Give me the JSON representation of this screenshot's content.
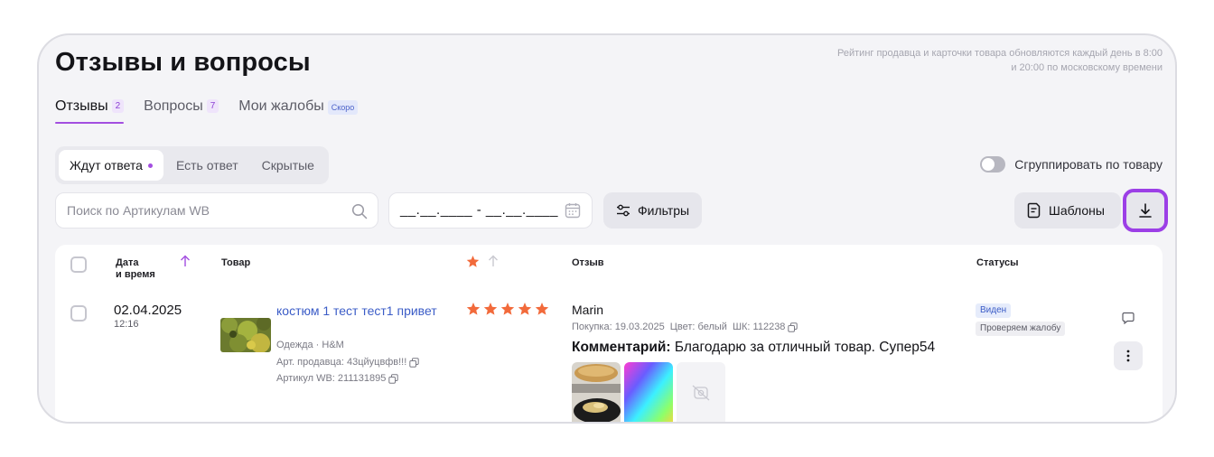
{
  "page": {
    "title": "Отзывы и вопросы",
    "info_note": "Рейтинг продавца и карточки товара обновляются каждый день в 8:00 и 20:00 по московскому времени"
  },
  "tabs": [
    {
      "label": "Отзывы",
      "count": "2"
    },
    {
      "label": "Вопросы",
      "count": "7"
    },
    {
      "label": "Мои жалобы",
      "badge": "Скоро"
    }
  ],
  "segments": [
    {
      "label": "Ждут ответа"
    },
    {
      "label": "Есть ответ"
    },
    {
      "label": "Скрытые"
    }
  ],
  "group_toggle": {
    "label": "Сгруппировать по товару"
  },
  "search": {
    "placeholder": "Поиск по Артикулам WB"
  },
  "date_range": {
    "value": "__.__.____ - __.__.____"
  },
  "toolbar": {
    "filters_label": "Фильтры",
    "templates_label": "Шаблоны"
  },
  "table": {
    "headers": {
      "date": "Дата\nи время",
      "product": "Товар",
      "review": "Отзыв",
      "statuses": "Статусы"
    }
  },
  "review": {
    "date": "02.04.2025",
    "time": "12:16",
    "product": {
      "name": "костюм 1 тест тест1 привет",
      "category": "Одежда · H&M",
      "seller_article": "Арт. продавца: 43цйуцвфв!!!",
      "wb_article": "Артикул WB: 211131895"
    },
    "rating": 5,
    "reviewer": "Marin",
    "purchase": "Покупка: 19.03.2025",
    "color": "Цвет: белый",
    "shk": "ШК: 112238",
    "comment_label": "Комментарий:",
    "comment_text": " Благодарю за отличный товар. Супер54",
    "statuses": [
      "Виден",
      "Проверяем жалобу"
    ]
  },
  "colors": {
    "accent": "#a34ee0",
    "star": "#f26a3b",
    "link": "#3b5cc7"
  }
}
